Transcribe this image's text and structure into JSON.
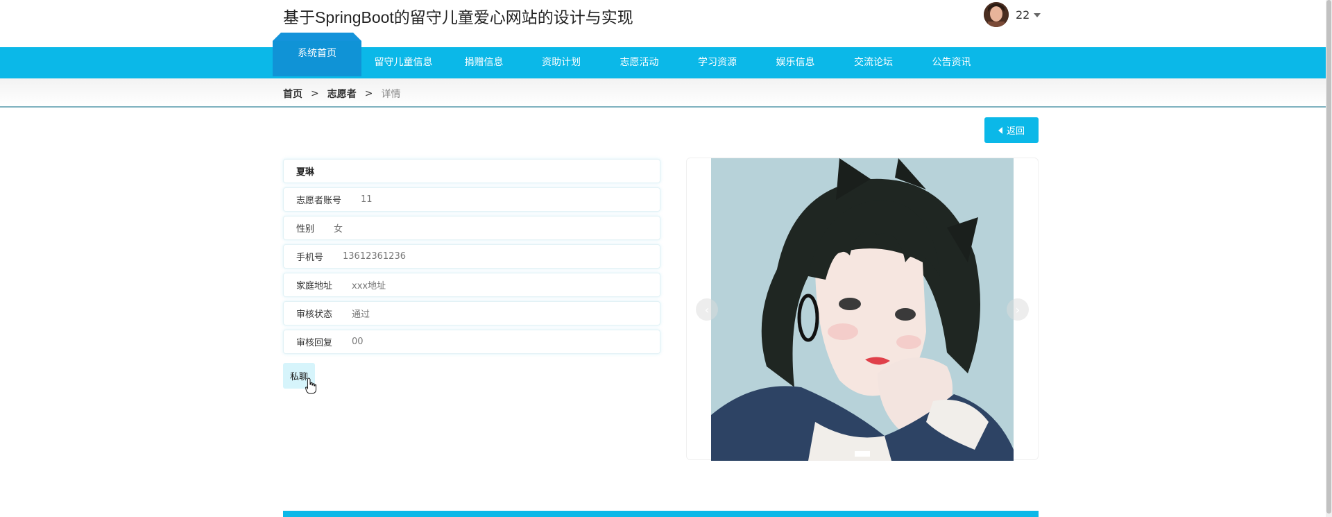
{
  "header": {
    "title": "基于SpringBoot的留守儿童爱心网站的设计与实现",
    "user_name": "22"
  },
  "nav": {
    "items": [
      {
        "label": "系统首页"
      },
      {
        "label": "留守儿童信息"
      },
      {
        "label": "捐赠信息"
      },
      {
        "label": "资助计划"
      },
      {
        "label": "志愿活动"
      },
      {
        "label": "学习资源"
      },
      {
        "label": "娱乐信息"
      },
      {
        "label": "交流论坛"
      },
      {
        "label": "公告资讯"
      }
    ]
  },
  "breadcrumb": {
    "home": "首页",
    "section": "志愿者",
    "current": "详情",
    "separator": ">"
  },
  "actions": {
    "back_label": "返回",
    "message_label": "私聊"
  },
  "detail": {
    "name": "夏琳",
    "fields": [
      {
        "label": "志愿者账号",
        "value": "11"
      },
      {
        "label": "性别",
        "value": "女"
      },
      {
        "label": "手机号",
        "value": "13612361236"
      },
      {
        "label": "家庭地址",
        "value": "xxx地址"
      },
      {
        "label": "审核状态",
        "value": "通过"
      },
      {
        "label": "审核回复",
        "value": "00"
      }
    ]
  },
  "carousel": {
    "prev_icon": "‹",
    "next_icon": "›"
  },
  "colors": {
    "primary": "#0bb8e8",
    "nav_active": "#1093d6"
  }
}
